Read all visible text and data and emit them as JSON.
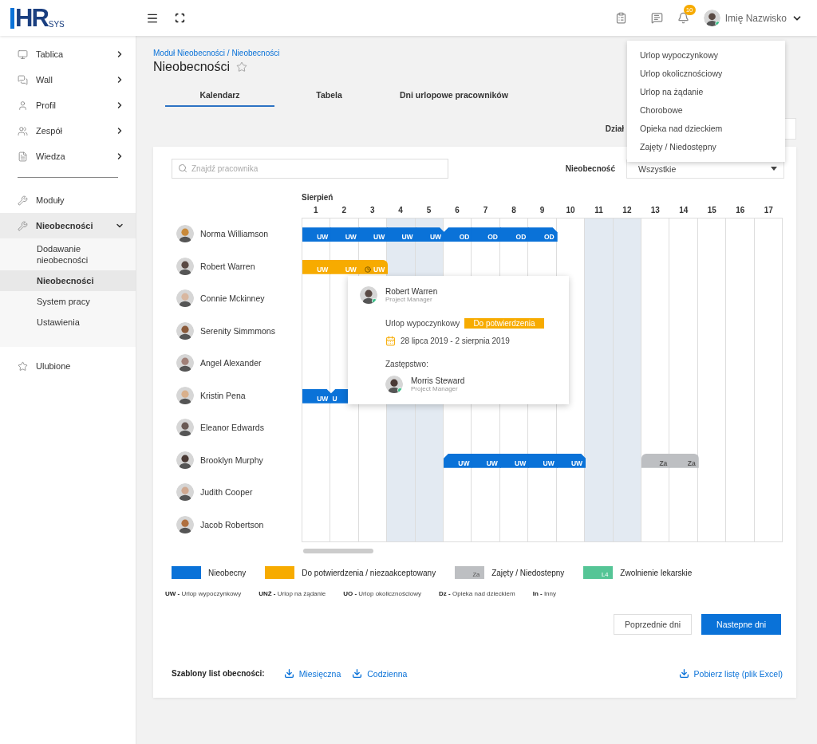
{
  "logo": {
    "main": "HR",
    "sub": "SYS"
  },
  "header": {
    "notifications": "10",
    "user": "Imię Nazwisko"
  },
  "sidebar": {
    "items": [
      {
        "label": "Tablica",
        "expandable": true,
        "expanded": false
      },
      {
        "label": "Wall",
        "expandable": true,
        "expanded": false
      },
      {
        "label": "Profil",
        "expandable": true,
        "expanded": false
      },
      {
        "label": "Zespół",
        "expandable": true,
        "expanded": false
      },
      {
        "label": "Wiedza",
        "expandable": true,
        "expanded": false
      },
      {
        "kind": "divider"
      },
      {
        "label": "Moduły",
        "expandable": false,
        "expanded": false
      },
      {
        "label": "Nieobecności",
        "expandable": true,
        "expanded": true,
        "children": [
          {
            "label": "Dodawanie nieobecności",
            "selected": false
          },
          {
            "label": "Nieobecności",
            "selected": true
          },
          {
            "label": "System pracy",
            "selected": false
          },
          {
            "label": "Ustawienia",
            "selected": false
          }
        ]
      },
      {
        "label": "Ulubione",
        "expandable": false,
        "expanded": false
      }
    ]
  },
  "breadcrumb": "Moduł Nieobecności / Nieobecności",
  "title": "Nieobecności",
  "tabs": [
    {
      "label": "Kalendarz",
      "selected": true
    },
    {
      "label": "Tabela",
      "selected": false
    },
    {
      "label": "Dni urlopowe pracowników",
      "selected": false
    }
  ],
  "department": {
    "label": "Dział"
  },
  "dropdown": [
    "Urlop wypoczynkowy",
    "Urlop okolicznościowy",
    "Urlop na żądanie",
    "Chorobowe",
    "Opieka nad dzieckiem",
    "Zajęty / Niedostępny"
  ],
  "search": {
    "placeholder": "Znajdź pracownika"
  },
  "absence_filter": {
    "label": "Nieobecność",
    "value": "Wszystkie"
  },
  "calendar": {
    "month": "Sierpień",
    "days": [
      {
        "label": "1",
        "shaded": false
      },
      {
        "label": "2",
        "shaded": false
      },
      {
        "label": "3",
        "shaded": false
      },
      {
        "label": "4",
        "shaded": true
      },
      {
        "label": "5",
        "shaded": true
      },
      {
        "label": "6",
        "shaded": false
      },
      {
        "label": "7",
        "shaded": false
      },
      {
        "label": "8",
        "shaded": false
      },
      {
        "label": "9",
        "shaded": false
      },
      {
        "label": "10",
        "shaded": false
      },
      {
        "label": "11",
        "shaded": true
      },
      {
        "label": "12",
        "shaded": true
      },
      {
        "label": "13",
        "shaded": false
      },
      {
        "label": "14",
        "shaded": false
      },
      {
        "label": "15",
        "shaded": false
      },
      {
        "label": "16",
        "shaded": false
      },
      {
        "label": "17",
        "shaded": false
      }
    ],
    "employees": [
      {
        "name": "Norma Williamson",
        "cells": [
          {
            "code": "UW",
            "kind": "absent"
          },
          {
            "code": "UW",
            "kind": "absent"
          },
          {
            "code": "UW",
            "kind": "absent"
          },
          {
            "code": "UW",
            "kind": "absent"
          },
          {
            "code": "UW",
            "kind": "absent"
          },
          {
            "code": "OD",
            "kind": "absent"
          },
          {
            "code": "OD",
            "kind": "absent"
          },
          {
            "code": "OD",
            "kind": "absent"
          },
          {
            "code": "OD",
            "kind": "absent"
          }
        ]
      },
      {
        "name": "Robert Warren",
        "cells": [
          {
            "code": "UW",
            "kind": "pending",
            "clock": false
          },
          {
            "code": "UW",
            "kind": "pending",
            "clock": false
          },
          {
            "code": "UW",
            "kind": "pending",
            "clock": true
          }
        ]
      },
      {
        "name": "Connie Mckinney"
      },
      {
        "name": "Serenity Simmmons"
      },
      {
        "name": "Angel Alexander"
      },
      {
        "name": "Kristin Pena",
        "cells": [
          {
            "code": "UW",
            "kind": "absent"
          },
          {
            "code": "U",
            "kind": "absent"
          }
        ]
      },
      {
        "name": "Eleanor Edwards"
      },
      {
        "name": "Brooklyn Murphy",
        "cells": [
          null,
          null,
          null,
          null,
          null,
          {
            "code": "UW",
            "kind": "absent"
          },
          {
            "code": "UW",
            "kind": "absent"
          },
          {
            "code": "UW",
            "kind": "absent"
          },
          {
            "code": "UW",
            "kind": "absent"
          },
          {
            "code": "UW",
            "kind": "absent"
          },
          null,
          null,
          {
            "code": "Za",
            "kind": "busy"
          },
          {
            "code": "Za",
            "kind": "busy"
          }
        ]
      },
      {
        "name": "Judith Cooper"
      },
      {
        "name": "Jacob Robertson"
      }
    ]
  },
  "popover": {
    "name": "Robert Warren",
    "role": "Project Manager",
    "type": "Urlop wypoczynkowy",
    "status": "Do potwierdzenia",
    "dates": "28 lipca 2019 - 2 sierpnia 2019",
    "substitute_label": "Zastępstwo:",
    "substitute": {
      "name": "Morris Steward",
      "role": "Project Manager"
    }
  },
  "legend": [
    {
      "kind": "absent",
      "label": "Nieobecny"
    },
    {
      "kind": "pending",
      "label": "Do potwierdzenia / niezaakceptowany"
    },
    {
      "kind": "busy",
      "code": "Za",
      "label": "Zajęty / Niedostepny"
    },
    {
      "kind": "sick",
      "code": "L4",
      "label": "Zwolnienie lekarskie"
    }
  ],
  "abbreviations": [
    {
      "code": "UW -",
      "label": "Urlop wypoczynkowy"
    },
    {
      "code": "UNŻ -",
      "label": "Urlop na żądanie"
    },
    {
      "code": "UO -",
      "label": "Urlop okolicznościowy"
    },
    {
      "code": "Dz -",
      "label": "Opieka nad dzieckiem"
    },
    {
      "code": "In -",
      "label": "Inny"
    }
  ],
  "buttons": {
    "previous": "Poprzednie dni",
    "next": "Nastepne dni"
  },
  "footer": {
    "label": "Szablony list obecności:",
    "templates": [
      "Miesięczna",
      "Codzienna"
    ],
    "download": "Pobierz listę (plik Excel)"
  }
}
